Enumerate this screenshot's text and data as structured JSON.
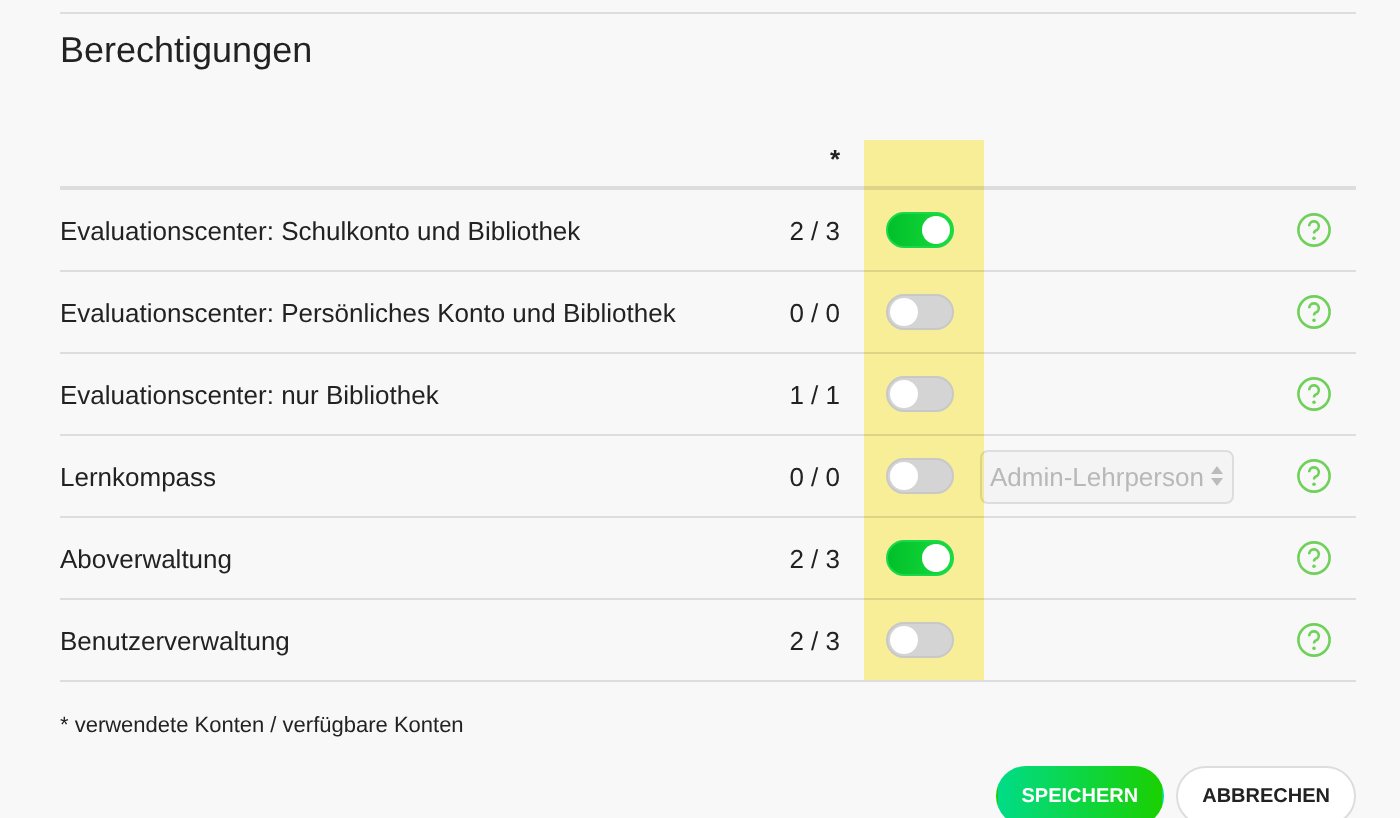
{
  "title": "Berechtigungen",
  "count_header": "*",
  "rows": [
    {
      "label": "Evaluationscenter: Schulkonto und Bibliothek",
      "count": "2 / 3",
      "on": true
    },
    {
      "label": "Evaluationscenter: Persönliches Konto und Bibliothek",
      "count": "0 / 0",
      "on": false
    },
    {
      "label": "Evaluationscenter: nur Bibliothek",
      "count": "1 / 1",
      "on": false
    },
    {
      "label": "Lernkompass",
      "count": "0 / 0",
      "on": false,
      "select": {
        "value": "Admin-Lehrperson",
        "disabled": true
      }
    },
    {
      "label": "Aboverwaltung",
      "count": "2 / 3",
      "on": true
    },
    {
      "label": "Benutzerverwaltung",
      "count": "2 / 3",
      "on": false
    }
  ],
  "footnote": "* verwendete Konten / verfügbare Konten",
  "buttons": [
    {
      "label": "SPEICHERN",
      "kind": "primary"
    },
    {
      "label": "ABBRECHEN",
      "kind": "secondary"
    }
  ]
}
